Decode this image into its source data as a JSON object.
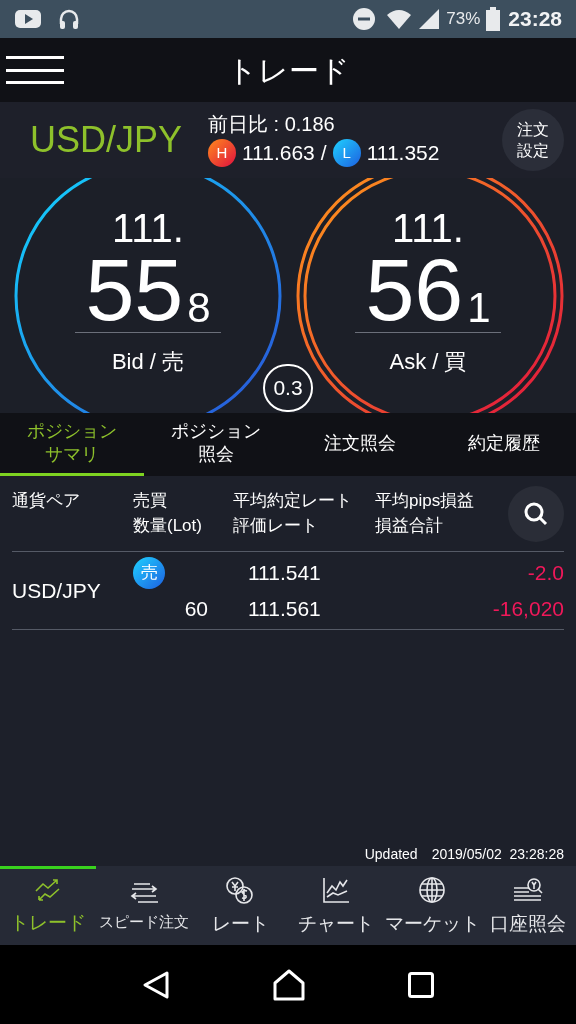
{
  "status_bar": {
    "battery": "73%",
    "time": "23:28"
  },
  "header": {
    "title": "トレード"
  },
  "pair_bar": {
    "pair": "USD/JPY",
    "change": "前日比 : 0.186",
    "high_badge": "H",
    "high": "111.663",
    "separator": "/",
    "low_badge": "L",
    "low": "111.352",
    "order_settings": "注文設定"
  },
  "quotes": [
    {
      "kind": "bid",
      "prefix": "111.",
      "big": "55",
      "small": "8",
      "label": "Bid / 売"
    },
    {
      "kind": "ask",
      "prefix": "111.",
      "big": "56",
      "small": "1",
      "label": "Ask / 買"
    }
  ],
  "spread": "0.3",
  "tabs": [
    {
      "label": "ポジションサマリ",
      "selected": true
    },
    {
      "label": "ポジション照会",
      "selected": false
    },
    {
      "label": "注文照会",
      "selected": false
    },
    {
      "label": "約定履歴",
      "selected": false
    }
  ],
  "table": {
    "columns": [
      {
        "top": "通貨ペア"
      },
      {
        "top": "売買",
        "bottom": "数量(Lot)"
      },
      {
        "top": "平均約定レート",
        "bottom": "評価レート"
      },
      {
        "top": "平均pips損益",
        "bottom": "損益合計"
      }
    ],
    "rows": [
      {
        "pair": "USD/JPY",
        "side": "売",
        "lots": "60",
        "avg_rate": "111.541",
        "eval_rate": "111.561",
        "pips": "-2.0",
        "total": "-16,020"
      }
    ]
  },
  "updated": {
    "label": "Updated",
    "datetime": "2019/05/02  23:28:28"
  },
  "bottom_nav": [
    {
      "label": "トレード",
      "selected": true
    },
    {
      "label": "スピード注文",
      "selected": false
    },
    {
      "label": "レート",
      "selected": false
    },
    {
      "label": "チャート",
      "selected": false
    },
    {
      "label": "マーケット",
      "selected": false
    },
    {
      "label": "口座照会",
      "selected": false
    }
  ]
}
